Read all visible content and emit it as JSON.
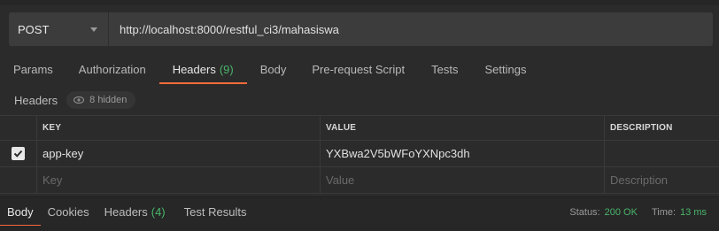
{
  "request": {
    "method": "POST",
    "url": "http://localhost:8000/restful_ci3/mahasiswa"
  },
  "tabs": [
    {
      "label": "Params"
    },
    {
      "label": "Authorization"
    },
    {
      "label": "Headers",
      "count": "(9)"
    },
    {
      "label": "Body"
    },
    {
      "label": "Pre-request Script"
    },
    {
      "label": "Tests"
    },
    {
      "label": "Settings"
    }
  ],
  "headers_section": {
    "title": "Headers",
    "hidden_label": "8 hidden"
  },
  "table": {
    "columns": [
      "KEY",
      "VALUE",
      "DESCRIPTION"
    ],
    "rows": [
      {
        "checked": true,
        "key": "app-key",
        "value": "YXBwa2V5bWFoYXNpc3dh",
        "description": ""
      }
    ],
    "placeholders": {
      "key": "Key",
      "value": "Value",
      "description": "Description"
    }
  },
  "response_tabs": [
    {
      "label": "Body"
    },
    {
      "label": "Cookies"
    },
    {
      "label": "Headers",
      "count": "(4)"
    },
    {
      "label": "Test Results"
    }
  ],
  "status": {
    "status_label": "Status:",
    "status_value": "200 OK",
    "time_label": "Time:",
    "time_value": "13 ms"
  },
  "colors": {
    "accent": "#f26b3a",
    "success": "#49b56a",
    "background": "#2b2b2b"
  }
}
